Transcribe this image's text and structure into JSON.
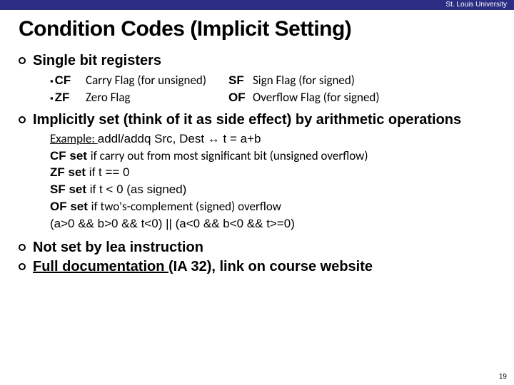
{
  "topbar": {
    "university": "St. Louis University"
  },
  "title": "Condition Codes (Implicit Setting)",
  "bullets": {
    "b1": "Single bit registers",
    "b2": "Implicitly set (think of it as side effect) by arithmetic operations",
    "b3": "Not set by lea instruction",
    "b4_pre": "Full documentation ",
    "b4_post": "(IA 32), link on course website"
  },
  "flags": {
    "r1": {
      "code": "CF",
      "desc": "Carry Flag (for unsigned)",
      "code2": "SF",
      "desc2": "Sign Flag (for signed)"
    },
    "r2": {
      "code": "ZF",
      "desc": "Zero Flag",
      "code2": "OF",
      "desc2": "Overflow Flag (for signed)"
    }
  },
  "example": {
    "l1_label": "Example: ",
    "l1_code": "addl/addq Src, Dest",
    "l1_eq": " ↔ t = a+b",
    "l2_b": "CF set ",
    "l2_t": "if carry out from most significant bit (unsigned overflow)",
    "l3_b": "ZF set ",
    "l3_t": "if t == 0",
    "l4_b": "SF set ",
    "l4_t": "if t < 0 (as signed)",
    "l5_b": "OF set ",
    "l5_t": "if two's-complement (signed) overflow",
    "l6": "(a>0 && b>0 && t<0) || (a<0 && b<0 && t>=0)"
  },
  "pagenum": "19"
}
